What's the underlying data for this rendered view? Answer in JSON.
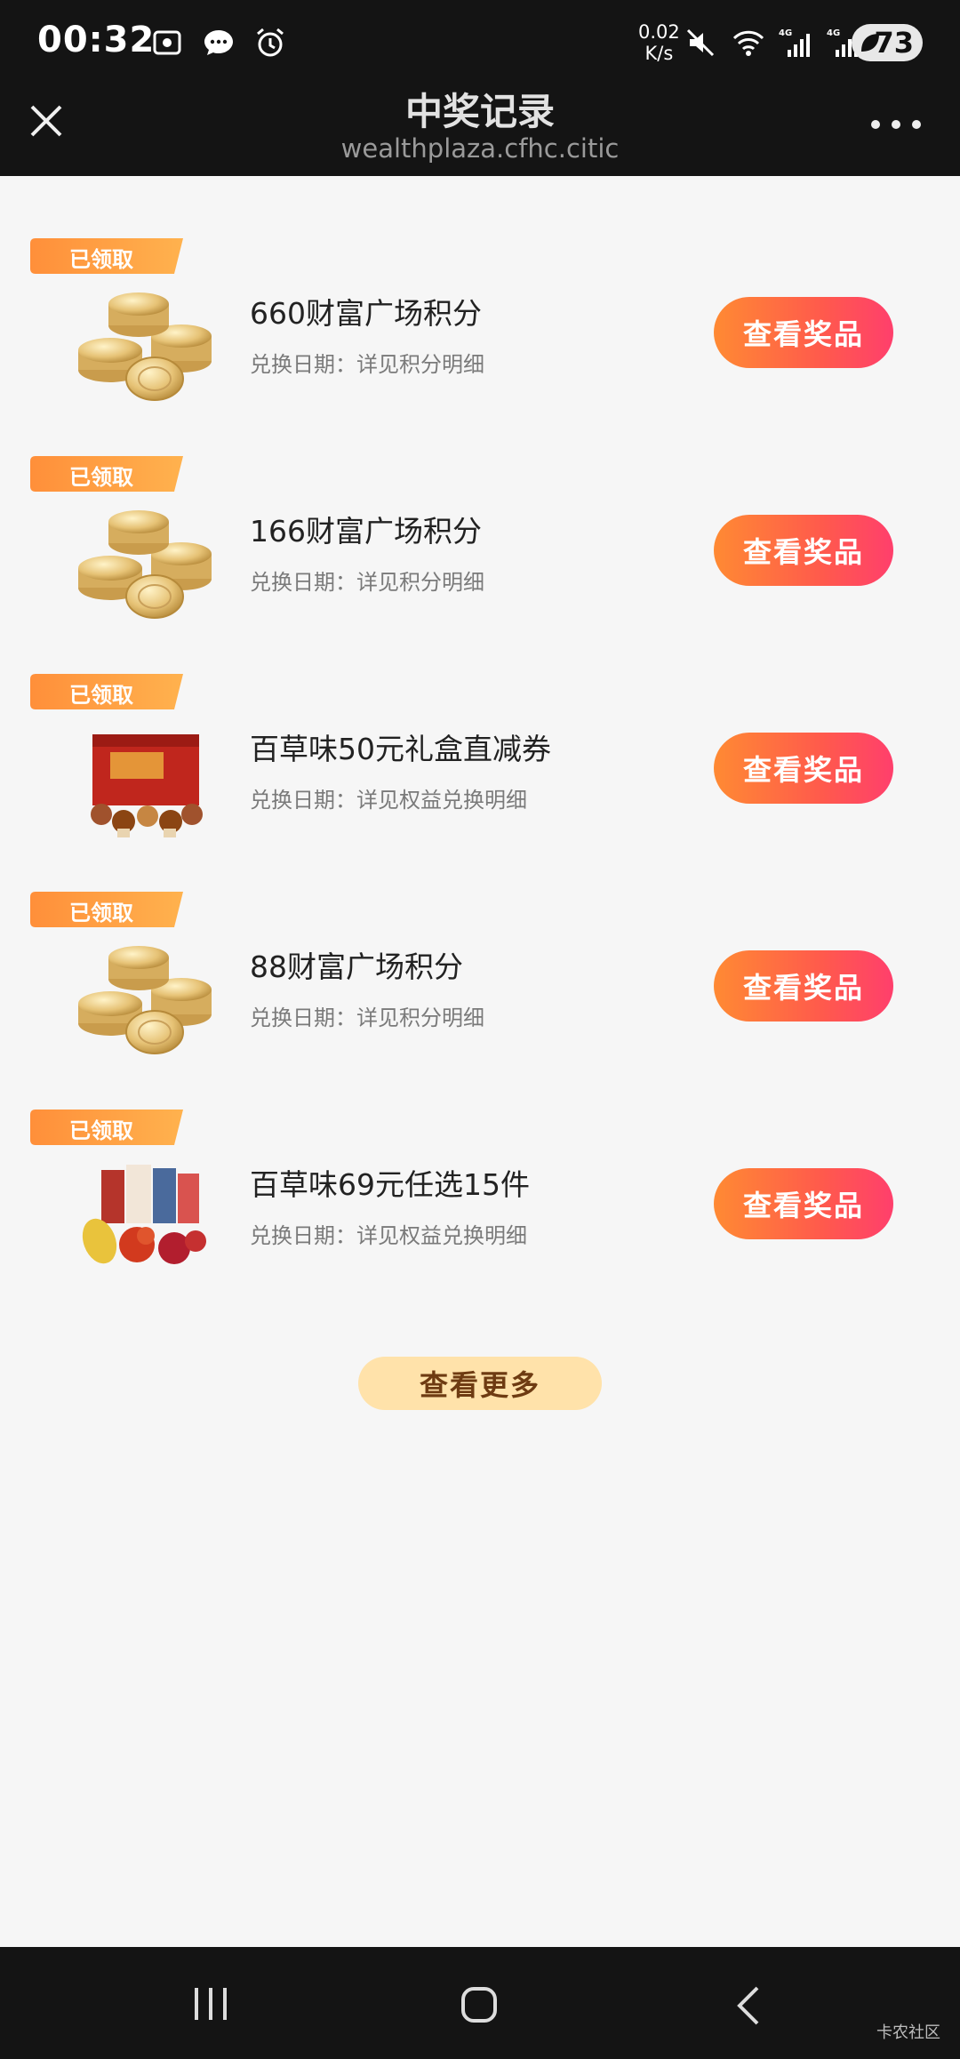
{
  "status_bar": {
    "time": "00:32",
    "speed_value": "0.02",
    "speed_unit": "K/s",
    "battery": "73",
    "network_1": "4G",
    "network_2": "4G"
  },
  "header": {
    "title": "中奖记录",
    "subtitle": "wealthplaza.cfhc.citic"
  },
  "records": [
    {
      "tag": "已领取",
      "title": "660财富广场积分",
      "date": "兑换日期：详见积分明细",
      "button": "查看奖品",
      "thumb": "coins"
    },
    {
      "tag": "已领取",
      "title": "166财富广场积分",
      "date": "兑换日期：详见积分明细",
      "button": "查看奖品",
      "thumb": "coins"
    },
    {
      "tag": "已领取",
      "title": "百草味50元礼盒直减券",
      "date": "兑换日期：详见权益兑换明细",
      "button": "查看奖品",
      "thumb": "gift-box"
    },
    {
      "tag": "已领取",
      "title": "88财富广场积分",
      "date": "兑换日期：详见积分明细",
      "button": "查看奖品",
      "thumb": "coins"
    },
    {
      "tag": "已领取",
      "title": "百草味69元任选15件",
      "date": "兑换日期：详见权益兑换明细",
      "button": "查看奖品",
      "thumb": "snacks"
    }
  ],
  "more_button": "查看更多",
  "watermark": "卡农社区",
  "colors": {
    "tag_orange": "#ff9f3a",
    "button_start": "#ff8a33",
    "button_end": "#ff3f6c",
    "more_bg": "#ffe2aa"
  }
}
